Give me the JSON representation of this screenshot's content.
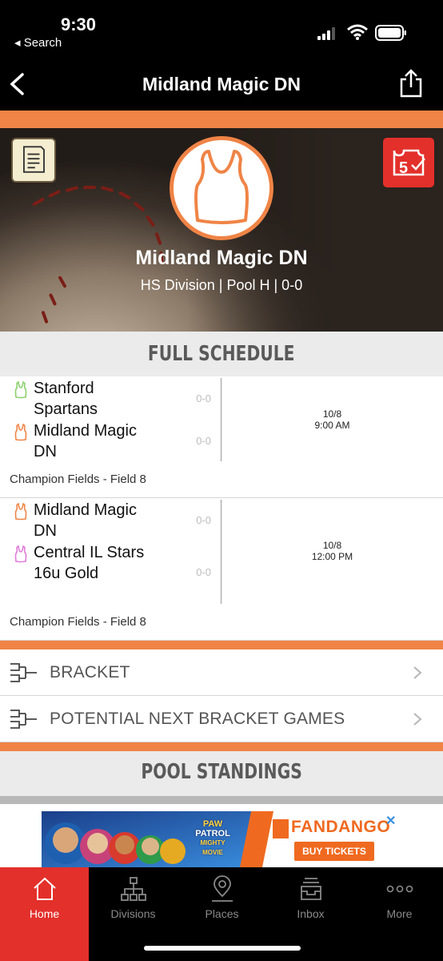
{
  "status_bar": {
    "time": "9:30",
    "back_label": "◂ Search"
  },
  "nav": {
    "title": "Midland Magic DN"
  },
  "team": {
    "name": "Midland Magic DN",
    "subtitle": "HS Division | Pool H | 0-0"
  },
  "colors": {
    "accent": "#ef8446",
    "tab_active": "#e3302b",
    "header_bg": "#ebebeb"
  },
  "schedule": {
    "header": "FULL SCHEDULE",
    "games": [
      {
        "team1": {
          "name": "Stanford Spartans",
          "record": "0-0",
          "jersey_color": "#8bd16a"
        },
        "team2": {
          "name": "Midland Magic DN",
          "record": "0-0",
          "jersey_color": "#ef8446"
        },
        "date": "10/8",
        "time": "9:00 AM",
        "location": "Champion Fields - Field 8"
      },
      {
        "team1": {
          "name": "Midland Magic DN",
          "record": "0-0",
          "jersey_color": "#ef8446"
        },
        "team2": {
          "name": "Central IL Stars 16u Gold",
          "record": "0-0",
          "jersey_color": "#e07ad8"
        },
        "date": "10/8",
        "time": "12:00 PM",
        "location": "Champion Fields - Field 8"
      }
    ]
  },
  "links": {
    "bracket": "BRACKET",
    "potential": "POTENTIAL NEXT BRACKET GAMES"
  },
  "pool_standings": {
    "header": "POOL STANDINGS"
  },
  "ad": {
    "brand": "FANDANGO",
    "button": "BUY TICKETS",
    "movie_top": "PAW",
    "movie_mid": "PATROL",
    "movie_bot": "MIGHTY MOVIE",
    "close": "✕"
  },
  "tabs": [
    {
      "label": "Home",
      "icon": "home-icon",
      "active": true
    },
    {
      "label": "Divisions",
      "icon": "hierarchy-icon",
      "active": false
    },
    {
      "label": "Places",
      "icon": "location-pin-icon",
      "active": false
    },
    {
      "label": "Inbox",
      "icon": "inbox-tray-icon",
      "active": false
    },
    {
      "label": "More",
      "icon": "more-dots-icon",
      "active": false
    }
  ]
}
